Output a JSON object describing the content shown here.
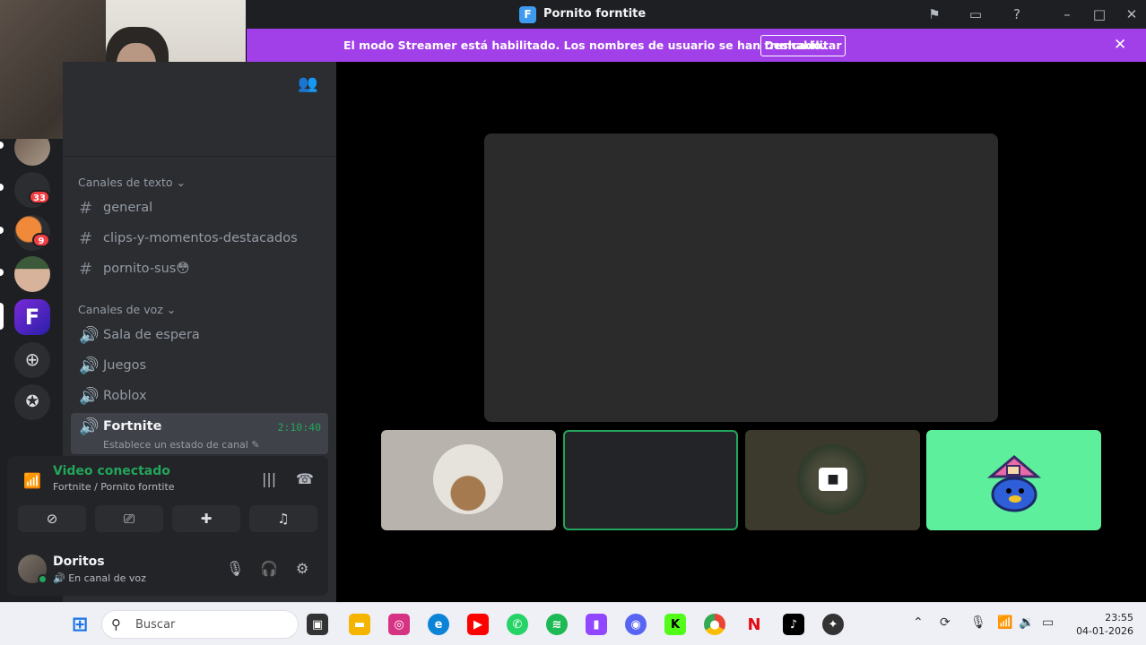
{
  "window": {
    "title": "Pornito forntite",
    "app_icon_letter": "F"
  },
  "banner": {
    "text": "El modo Streamer está habilitado. Los nombres de usuario se han truncado.",
    "button": "Deshabilitar"
  },
  "rail": {
    "badges": [
      "33",
      "9"
    ],
    "server_letter": "F"
  },
  "sidebar": {
    "text_category": "Canales de texto",
    "text_channels": [
      "general",
      "clips-y-momentos-destacados",
      "pornito-sus😳"
    ],
    "voice_category": "Canales de voz",
    "voice_channels": [
      "Sala de espera",
      "Juegos",
      "Roblox"
    ],
    "active_channel": {
      "name": "Fortnite",
      "timer": "2:10:40",
      "status": "Establece un estado de canal"
    }
  },
  "voice": {
    "title": "Video conectado",
    "location": "Fortnite / Pornito forntite"
  },
  "user": {
    "name": "Doritos",
    "status": "En canal de voz"
  },
  "taskbar": {
    "search_placeholder": "Buscar",
    "time": "23:55",
    "date": "04-01-2026"
  },
  "colors": {
    "banner": "#a13fe8",
    "connected_green": "#23a55a",
    "tile_green": "#5eef9c"
  }
}
